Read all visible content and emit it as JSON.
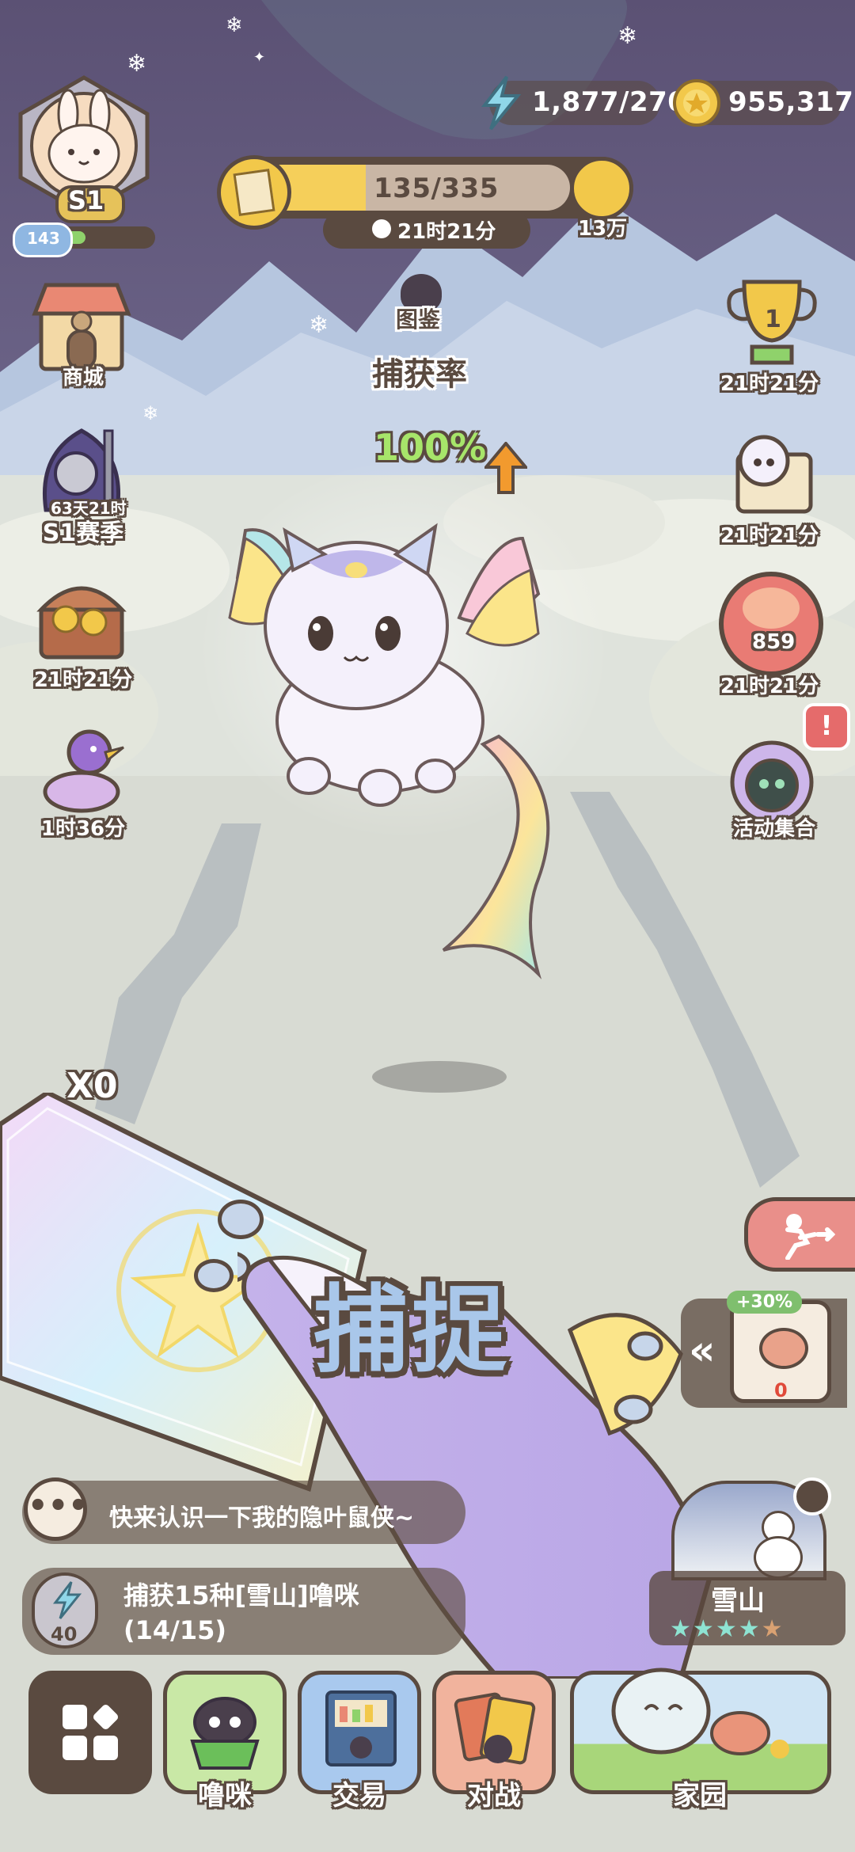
{
  "resources": {
    "energy": "1,877/270",
    "coins": "955,317"
  },
  "player": {
    "rank": "S1",
    "level": "143",
    "xp_fraction": 0.25
  },
  "event_bar": {
    "progress": "135/335",
    "progress_fraction": 0.4,
    "timer": "21时21分",
    "reward": "13万"
  },
  "catch": {
    "pokedex_label": "图鉴",
    "rate_label": "捕获率",
    "rate_value": "100%",
    "card_count": "X0",
    "action_label": "捕捉"
  },
  "left_menu": [
    {
      "label": "商城",
      "icon": "shop-icon"
    },
    {
      "label": "S1赛季",
      "sublabel": "63天21时",
      "icon": "season-knight-icon"
    },
    {
      "label": "21时21分",
      "icon": "treasure-chest-icon"
    },
    {
      "label": "1时36分",
      "icon": "bird-gift-icon"
    }
  ],
  "right_menu": [
    {
      "label": "21时21分",
      "badge": "1",
      "icon": "trophy-icon"
    },
    {
      "label": "21时21分",
      "icon": "map-scroll-icon"
    },
    {
      "label": "21时21分",
      "badge": "859",
      "icon": "candy-token-icon"
    },
    {
      "label": "活动集合",
      "icon": "event-collection-icon",
      "alert": "!"
    }
  ],
  "bait": {
    "bonus": "+30%",
    "count": "0",
    "icon": "candy-icon"
  },
  "chat": {
    "message": "快来认识一下我的隐叶鼠侠~"
  },
  "quest": {
    "energy": "40",
    "title": "捕获15种[雪山]噜咪",
    "progress": "(14/15)"
  },
  "location": {
    "name": "雪山",
    "stars_filled": 4,
    "stars_total": 5
  },
  "bottom_nav": [
    {
      "label": "",
      "icon": "menu-grid-icon"
    },
    {
      "label": "噜咪",
      "icon": "cat-bowl-icon"
    },
    {
      "label": "交易",
      "icon": "trade-shop-icon"
    },
    {
      "label": "对战",
      "icon": "battle-cards-icon"
    },
    {
      "label": "家园",
      "icon": "home-garden-icon"
    }
  ],
  "colors": {
    "sky": "#5f5476",
    "outline": "#5a4a40",
    "gold": "#f2c84a",
    "green": "#8fd26b",
    "rate_green": "#a7e56a"
  }
}
